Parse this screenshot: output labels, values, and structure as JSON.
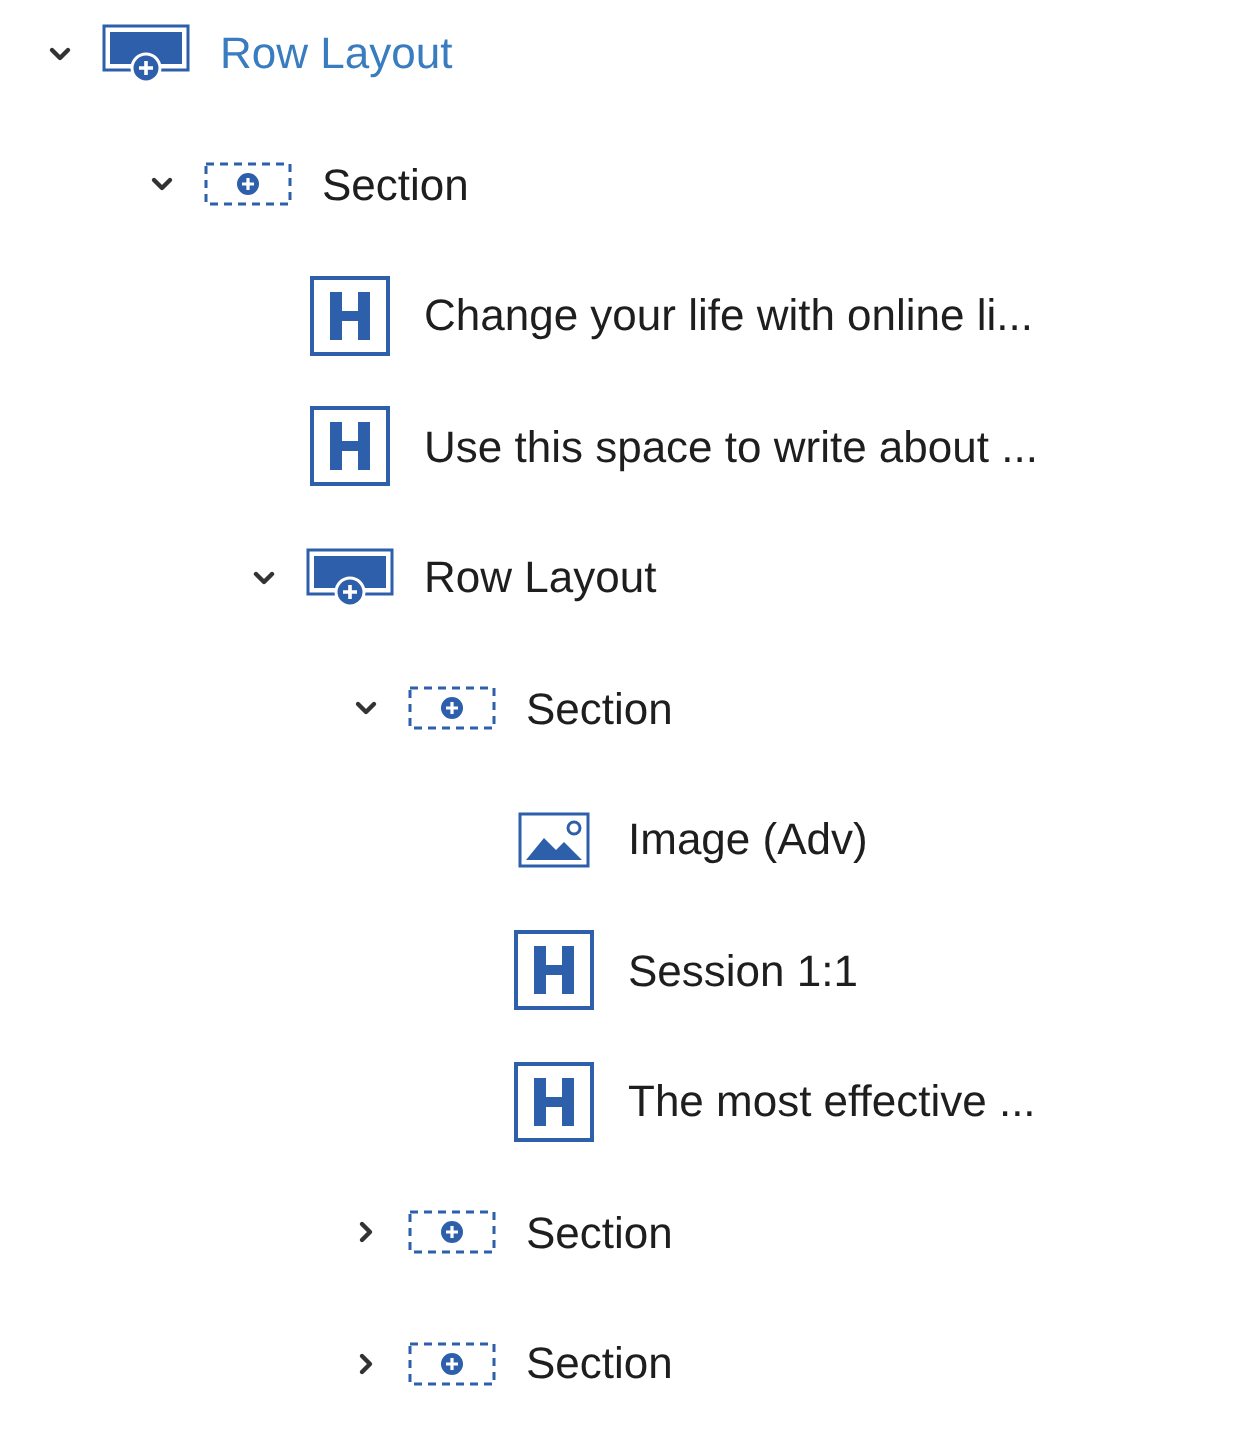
{
  "tree": [
    {
      "kind": "row",
      "label": "Row Layout",
      "selected": true,
      "expanded": true,
      "children": [
        {
          "kind": "section",
          "label": "Section",
          "selected": false,
          "expanded": true,
          "children": [
            {
              "kind": "heading",
              "label": "Change your life with online li...",
              "selected": false
            },
            {
              "kind": "heading",
              "label": "Use this space to write about ...",
              "selected": false
            },
            {
              "kind": "row",
              "label": "Row Layout",
              "selected": false,
              "expanded": true,
              "children": [
                {
                  "kind": "section",
                  "label": "Section",
                  "selected": false,
                  "expanded": true,
                  "children": [
                    {
                      "kind": "image",
                      "label": "Image (Adv)",
                      "selected": false
                    },
                    {
                      "kind": "heading",
                      "label": "Session 1:1",
                      "selected": false
                    },
                    {
                      "kind": "heading",
                      "label": "The most effective ...",
                      "selected": false
                    }
                  ]
                },
                {
                  "kind": "section",
                  "label": "Section",
                  "selected": false,
                  "expanded": false
                },
                {
                  "kind": "section",
                  "label": "Section",
                  "selected": false,
                  "expanded": false
                }
              ]
            }
          ]
        }
      ]
    }
  ]
}
